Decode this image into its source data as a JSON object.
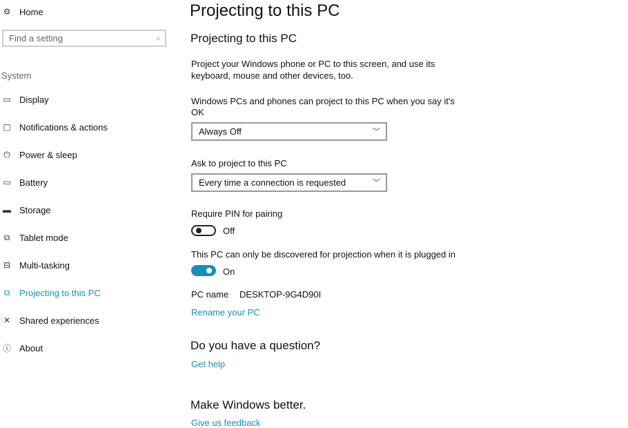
{
  "sidebar": {
    "home": "Home",
    "search_placeholder": "Find a setting",
    "section": "System",
    "items": [
      {
        "label": "Display",
        "icon": "monitor-icon"
      },
      {
        "label": "Notifications & actions",
        "icon": "notification-icon"
      },
      {
        "label": "Power & sleep",
        "icon": "power-icon"
      },
      {
        "label": "Battery",
        "icon": "battery-icon"
      },
      {
        "label": "Storage",
        "icon": "storage-icon"
      },
      {
        "label": "Tablet mode",
        "icon": "tablet-icon"
      },
      {
        "label": "Multi-tasking",
        "icon": "multitasking-icon"
      },
      {
        "label": "Projecting to this PC",
        "icon": "projecting-icon",
        "selected": true
      },
      {
        "label": "Shared experiences",
        "icon": "shared-icon"
      },
      {
        "label": "About",
        "icon": "info-icon"
      }
    ]
  },
  "main": {
    "title": "Projecting to this PC",
    "subtitle": "Projecting to this PC",
    "desc1": "Project your Windows phone or PC to this screen, and use its",
    "desc2": "keyboard, mouse and other devices, too.",
    "when_label1": "Windows PCs and phones can project to this PC when you say it's",
    "when_label2": "OK",
    "when_value": "Always Off",
    "ask_label": "Ask to project to this PC",
    "ask_value": "Every time a connection is requested",
    "pin_label": "Require PIN for pairing",
    "pin_state": "Off",
    "pin_on": false,
    "plugged_label": "This PC can only be discovered for projection when it is plugged in",
    "plugged_state": "On",
    "plugged_on": true,
    "pc_name_label": "PC name",
    "pc_name": "DESKTOP-9G4D90I",
    "rename": "Rename your PC",
    "question": "Do you have a question?",
    "get_help": "Get help",
    "better": "Make Windows better.",
    "feedback": "Give us feedback"
  },
  "colors": {
    "accent": "#1a8fb5"
  }
}
